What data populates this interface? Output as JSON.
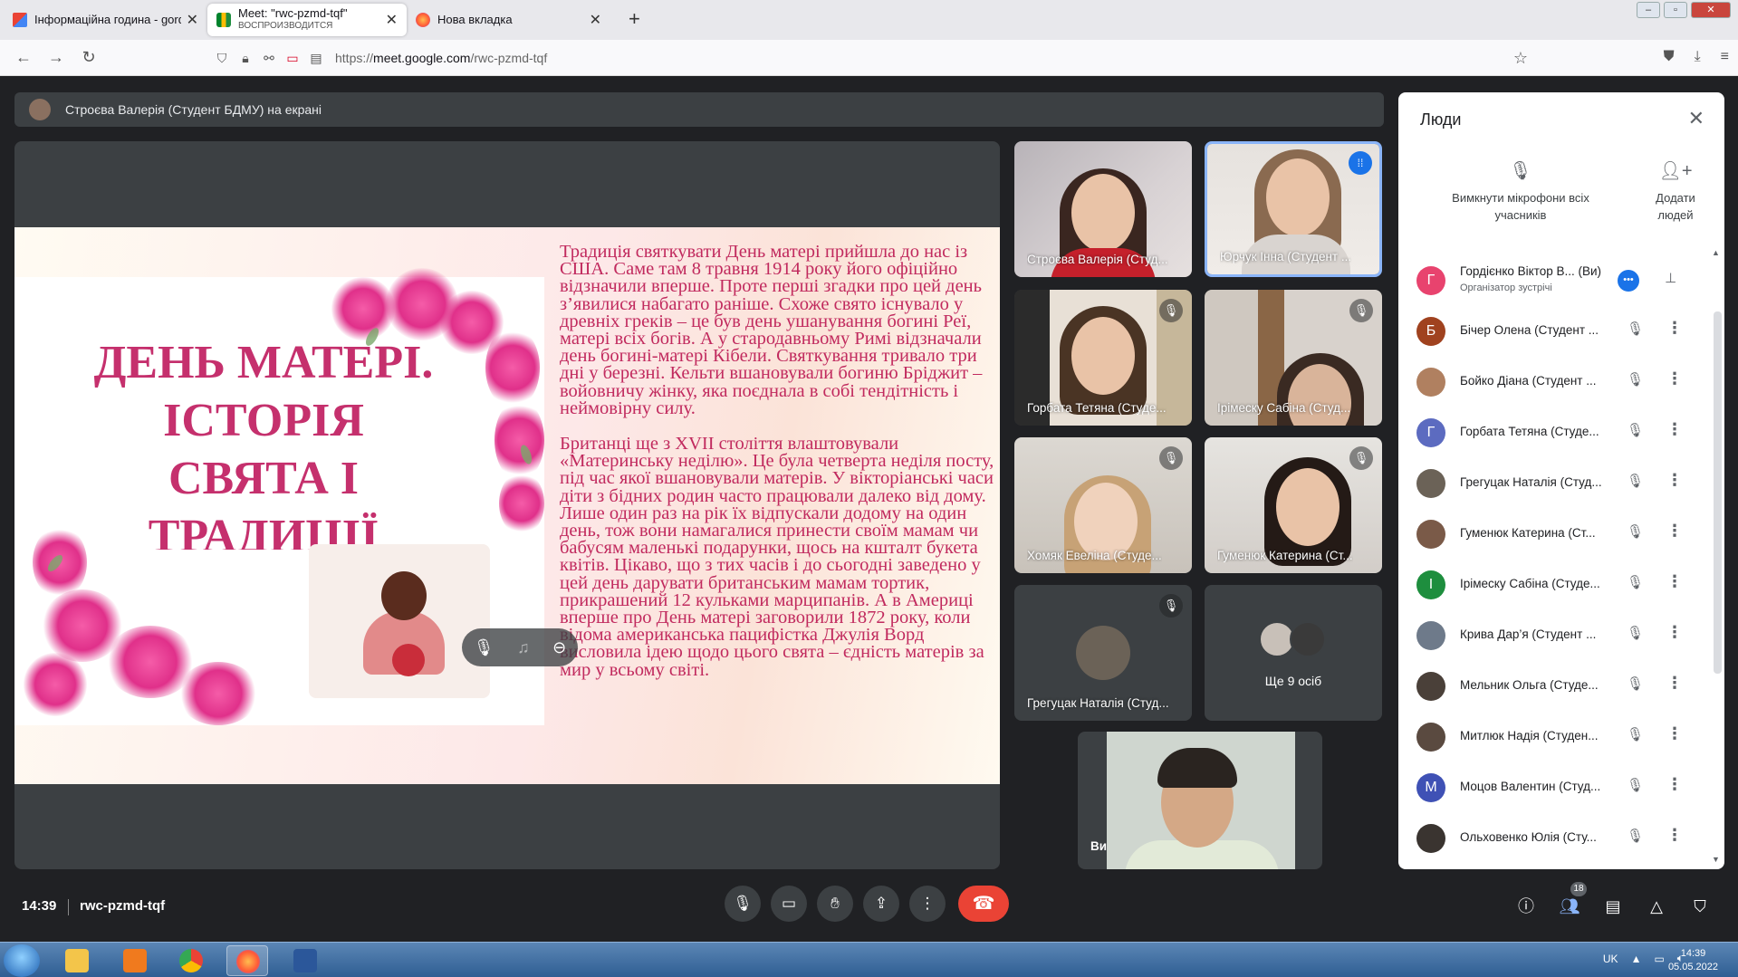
{
  "browser": {
    "tabs": [
      {
        "title": "Інформаційна година - gordie",
        "subtitle": "",
        "active": false
      },
      {
        "title": "Meet: \"rwc-pzmd-tqf\"",
        "subtitle": "ВОСПРОИЗВОДИТСЯ",
        "active": true
      },
      {
        "title": "Нова вкладка",
        "subtitle": "",
        "active": false
      }
    ],
    "url_prefix": "https://",
    "url_domain": "meet.google.com",
    "url_path": "/rwc-pzmd-tqf"
  },
  "screen_share": {
    "banner": "Строєва Валерія (Студент БДМУ) на екрані",
    "slide_title_lines": [
      "ДЕНЬ МАТЕРІ.",
      "ІСТОРІЯ",
      "СВЯТА І",
      "ТРАДИЦІЇ"
    ],
    "slide_paragraph_1": "Традиція святкувати День матері прийшла до нас із США. Саме там 8 травня 1914 року його офіційно відзначили вперше. Проте перші згадки про цей день з’явилися набагато раніше. Схоже свято існувало у древніх греків – це був день ушанування богині Реї, матері всіх богів. А у стародавньому Римі відзначали день богині-матері Кібели. Святкування тривало три дні у березні. Кельти вшановували богиню Бріджит – войовничу жінку, яка поєднала в собі тендітність і неймовірну силу.",
    "slide_paragraph_2": "Британці ще з XVII століття влаштовували «Материнську неділю». Це була четверта неділя посту, під час якої вшановували матерів. У вікторіанські часи діти з бідних родин часто працювали далеко від дому. Лише один раз на рік їх відпускали додому на один день, тож вони намагалися принести своїм мамам чи бабусям маленькі подарунки, щось на кшталт букета квітів. Цікаво, що з тих часів і до сьогодні заведено у цей день дарувати британським мамам тортик, прикрашений 12 кульками марципанів. А в Америці вперше про День матері заговорили 1872 року, коли відома американська пацифістка Джулія Ворд висловила ідею щодо цього свята – єдність матерів за мир у всьому світі."
  },
  "tiles": [
    {
      "name": "Строєва Валерія (Студ...",
      "muted": false,
      "speaking": false
    },
    {
      "name": "Юрчук Інна (Студент ...",
      "muted": false,
      "speaking": true
    },
    {
      "name": "Горбата Тетяна (Студе...",
      "muted": true,
      "speaking": false
    },
    {
      "name": "Ірімеску Сабіна (Студ...",
      "muted": true,
      "speaking": false
    },
    {
      "name": "Хомяк Евеліна (Студе...",
      "muted": true,
      "speaking": false
    },
    {
      "name": "Гуменюк Катерина (Ст...",
      "muted": true,
      "speaking": false
    },
    {
      "name": "Грегуцак Наталія (Студ...",
      "muted": true,
      "speaking": false
    }
  ],
  "more_tile_label": "Ще 9 осіб",
  "self_view_name": "Ви",
  "bottom": {
    "time": "14:39",
    "meeting_code": "rwc-pzmd-tqf",
    "participants_count": "18"
  },
  "people_panel": {
    "title": "Люди",
    "mute_all_label": "Вимкнути мікрофони всіх учасників",
    "add_people_label": "Додати людей",
    "participants": [
      {
        "initial": "Г",
        "name": "Гордієнко Віктор В... (Ви)",
        "role": "Організатор зустрічі",
        "color": "#e8436e",
        "host": true
      },
      {
        "initial": "Б",
        "name": "Бічер Олена (Студент ...",
        "role": "",
        "color": "#a0421f",
        "host": false
      },
      {
        "initial": "",
        "name": "Бойко Діана (Студент ...",
        "role": "",
        "color": "#b08060",
        "host": false
      },
      {
        "initial": "Г",
        "name": "Горбата Тетяна (Студе...",
        "role": "",
        "color": "#5c6bc0",
        "host": false
      },
      {
        "initial": "",
        "name": "Грегуцак Наталія (Студ...",
        "role": "",
        "color": "#6b6257",
        "host": false
      },
      {
        "initial": "",
        "name": "Гуменюк Катерина (Ст...",
        "role": "",
        "color": "#7a5a48",
        "host": false
      },
      {
        "initial": "І",
        "name": "Ірімеску Сабіна (Студе...",
        "role": "",
        "color": "#1e8e3e",
        "host": false
      },
      {
        "initial": "",
        "name": "Крива Дар’я (Студент ...",
        "role": "",
        "color": "#6e7a8a",
        "host": false
      },
      {
        "initial": "",
        "name": "Мельник Ольга (Студе...",
        "role": "",
        "color": "#4a4039",
        "host": false
      },
      {
        "initial": "",
        "name": "Митлюк Надія (Студен...",
        "role": "",
        "color": "#5a4a40",
        "host": false
      },
      {
        "initial": "М",
        "name": "Моцов Валентин (Студ...",
        "role": "",
        "color": "#3f51b5",
        "host": false
      },
      {
        "initial": "",
        "name": "Ольховенко Юлія (Сту...",
        "role": "",
        "color": "#3a3430",
        "host": false
      }
    ]
  },
  "taskbar": {
    "lang": "UK",
    "time": "14:39",
    "date": "05.05.2022"
  },
  "colors": {
    "meet_bg": "#202124",
    "tile_bg": "#3c4043",
    "accent": "#1a73e8",
    "end_call": "#ea4335",
    "slide_text": "#c12a5e"
  }
}
